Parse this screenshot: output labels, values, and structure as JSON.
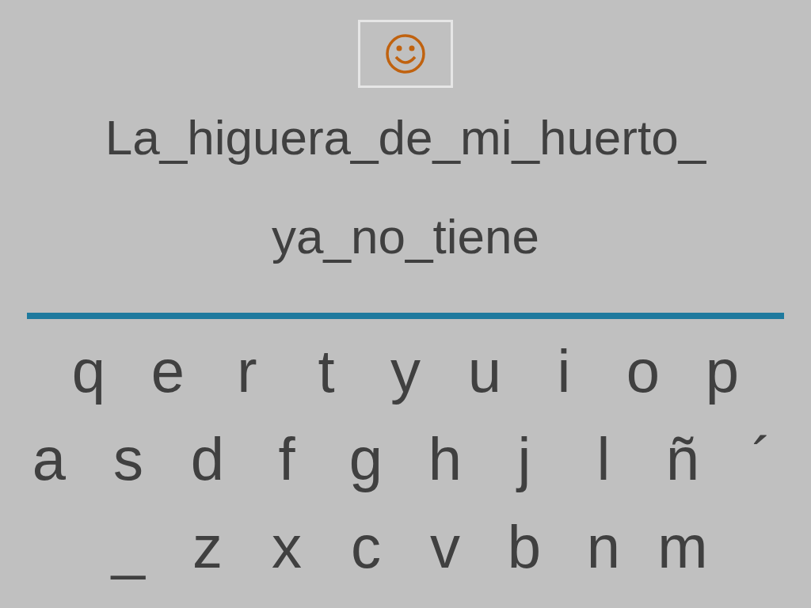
{
  "sentence_lines": [
    "La_higuera_de_mi_huerto_",
    "ya_no_tiene"
  ],
  "keyboard_rows": [
    [
      "q",
      "e",
      "r",
      "t",
      "y",
      "u",
      "i",
      "o",
      "p"
    ],
    [
      "a",
      "s",
      "d",
      "f",
      "g",
      "h",
      "j",
      "l",
      "ñ",
      "´"
    ],
    [
      "_",
      "z",
      "x",
      "c",
      "v",
      "b",
      "n",
      "m"
    ]
  ]
}
